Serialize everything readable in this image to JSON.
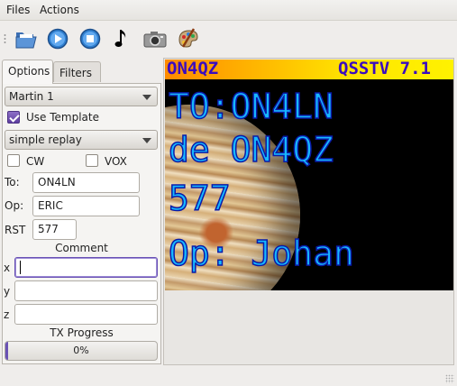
{
  "menu": {
    "files": "Files",
    "actions": "Actions"
  },
  "toolbar": {
    "icons": [
      "open-folder-icon",
      "play-icon",
      "stop-icon",
      "music-note-icon",
      "camera-icon",
      "paint-palette-icon"
    ]
  },
  "tabs": [
    {
      "label": "Options"
    },
    {
      "label": "Filters"
    }
  ],
  "options": {
    "mode": "Martin 1",
    "use_template_label": "Use Template",
    "use_template_checked": true,
    "template": "simple replay",
    "cw_label": "CW",
    "vox_label": "VOX",
    "to_label": "To:",
    "to_value": "ON4LN",
    "op_label": "Op:",
    "op_value": "ERIC",
    "rst_label": "RST",
    "rst_value": "577",
    "comment_label": "Comment",
    "x_label": "x",
    "x_value": "",
    "y_label": "y",
    "y_value": "",
    "z_label": "z",
    "z_value": "",
    "tx_progress_label": "TX Progress",
    "tx_progress_text": "0%",
    "tx_progress_value": 0.0
  },
  "image": {
    "header_left": "ON4QZ",
    "header_right": "QSSTV 7.1",
    "line1": "TO:ON4LN",
    "line2": "de ON4QZ",
    "line3": "577",
    "line4": "Op: Johan",
    "colors": {
      "text_fill": "#17b8ff",
      "text_outline": "#0a1aa8",
      "header_text": "#3a0cbf"
    }
  }
}
